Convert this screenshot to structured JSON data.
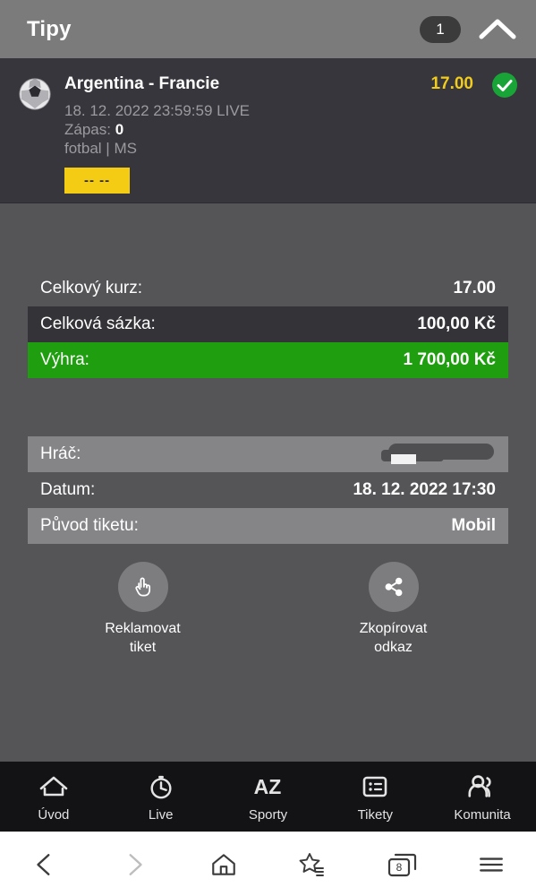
{
  "header": {
    "title": "Tipy",
    "badge_count": "1",
    "collapse_icon": "chevron-up-icon"
  },
  "ticket": {
    "sport_icon": "soccer-ball-icon",
    "match_name": "Argentina - Francie",
    "datetime": "18. 12. 2022 23:59:59 LIVE",
    "score_label": "Zápas:",
    "score_value": "0",
    "category": "fotbal | MS",
    "pick_badge": "-- --",
    "odds": "17.00",
    "status_icon": "check-circle-icon"
  },
  "summary": {
    "rows": [
      {
        "label": "Celkový kurz:",
        "value": "17.00",
        "style": "plain"
      },
      {
        "label": "Celková sázka:",
        "value": "100,00 Kč",
        "style": "dark"
      },
      {
        "label": "Výhra:",
        "value": "1 700,00 Kč",
        "style": "green"
      }
    ]
  },
  "details": {
    "rows": [
      {
        "label": "Hráč:",
        "value": "",
        "style": "light",
        "redacted": true
      },
      {
        "label": "Datum:",
        "value": "18. 12. 2022 17:30",
        "style": "plain"
      },
      {
        "label": "Původ tiketu:",
        "value": "Mobil",
        "style": "light"
      }
    ]
  },
  "actions": [
    {
      "icon": "pointing-hand-icon",
      "label": "Reklamovat\ntiket",
      "line1": "Reklamovat",
      "line2": "tiket"
    },
    {
      "icon": "share-icon",
      "label": "Zkopírovat\nodkaz",
      "line1": "Zkopírovat",
      "line2": "odkaz"
    }
  ],
  "bottom_nav": [
    {
      "icon": "home-icon",
      "label": "Úvod"
    },
    {
      "icon": "stopwatch-icon",
      "label": "Live"
    },
    {
      "icon": "az-icon",
      "label": "Sporty"
    },
    {
      "icon": "list-icon",
      "label": "Tikety"
    },
    {
      "icon": "people-icon",
      "label": "Komunita"
    }
  ],
  "browser_bar": {
    "back": "back-arrow-icon",
    "forward": "forward-arrow-icon",
    "home": "home-outline-icon",
    "bookmarks": "star-list-icon",
    "tabs_icon": "tabs-icon",
    "tabs_count": "8",
    "menu": "hamburger-menu-icon"
  },
  "colors": {
    "header_bg": "#7b7b7b",
    "card_bg": "#36363c",
    "body_bg": "#555558",
    "accent_yellow": "#f2cc1d",
    "win_green": "#1f9e0f",
    "nav_bg": "#131316"
  }
}
